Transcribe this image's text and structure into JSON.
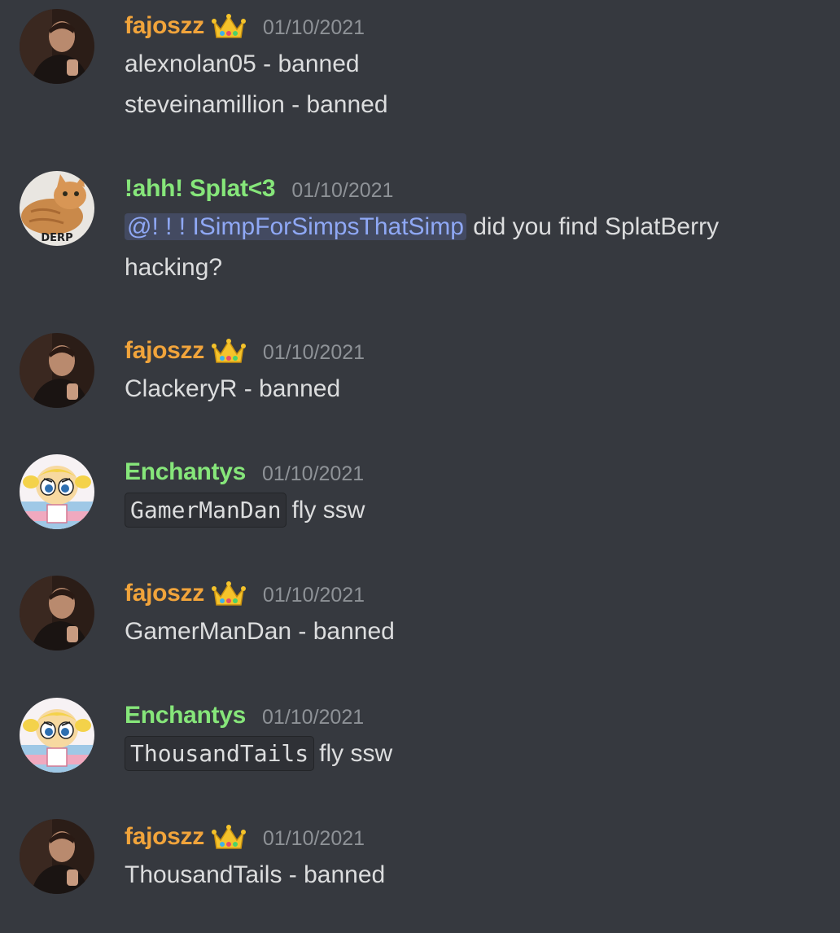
{
  "messages": [
    {
      "author": "fajoszz",
      "crown": true,
      "timestamp": "01/10/2021",
      "lines": [
        "alexnolan05 - banned",
        "steveinamillion - banned"
      ]
    },
    {
      "author": "!ahh! Splat<3",
      "timestamp": "01/10/2021",
      "avatar_text": "DERP",
      "mention": "@! ! ! ISimpForSimpsThatSimp",
      "text_after_mention": "did you find SplatBerry hacking?"
    },
    {
      "author": "fajoszz",
      "crown": true,
      "timestamp": "01/10/2021",
      "lines": [
        "ClackeryR - banned"
      ]
    },
    {
      "author": "Enchantys",
      "timestamp": "01/10/2021",
      "code": "GamerManDan",
      "text_after_code": "fly ssw"
    },
    {
      "author": "fajoszz",
      "crown": true,
      "timestamp": "01/10/2021",
      "lines": [
        "GamerManDan - banned"
      ]
    },
    {
      "author": "Enchantys",
      "timestamp": "01/10/2021",
      "code": "ThousandTails",
      "text_after_code": "fly ssw"
    },
    {
      "author": "fajoszz",
      "crown": true,
      "timestamp": "01/10/2021",
      "lines": [
        "ThousandTails - banned"
      ]
    }
  ],
  "colors": {
    "background": "#36393f",
    "author_gold": "#f1a43b",
    "author_green": "#86e67a",
    "timestamp": "#8e9297",
    "mention": "#8fa8f5"
  }
}
